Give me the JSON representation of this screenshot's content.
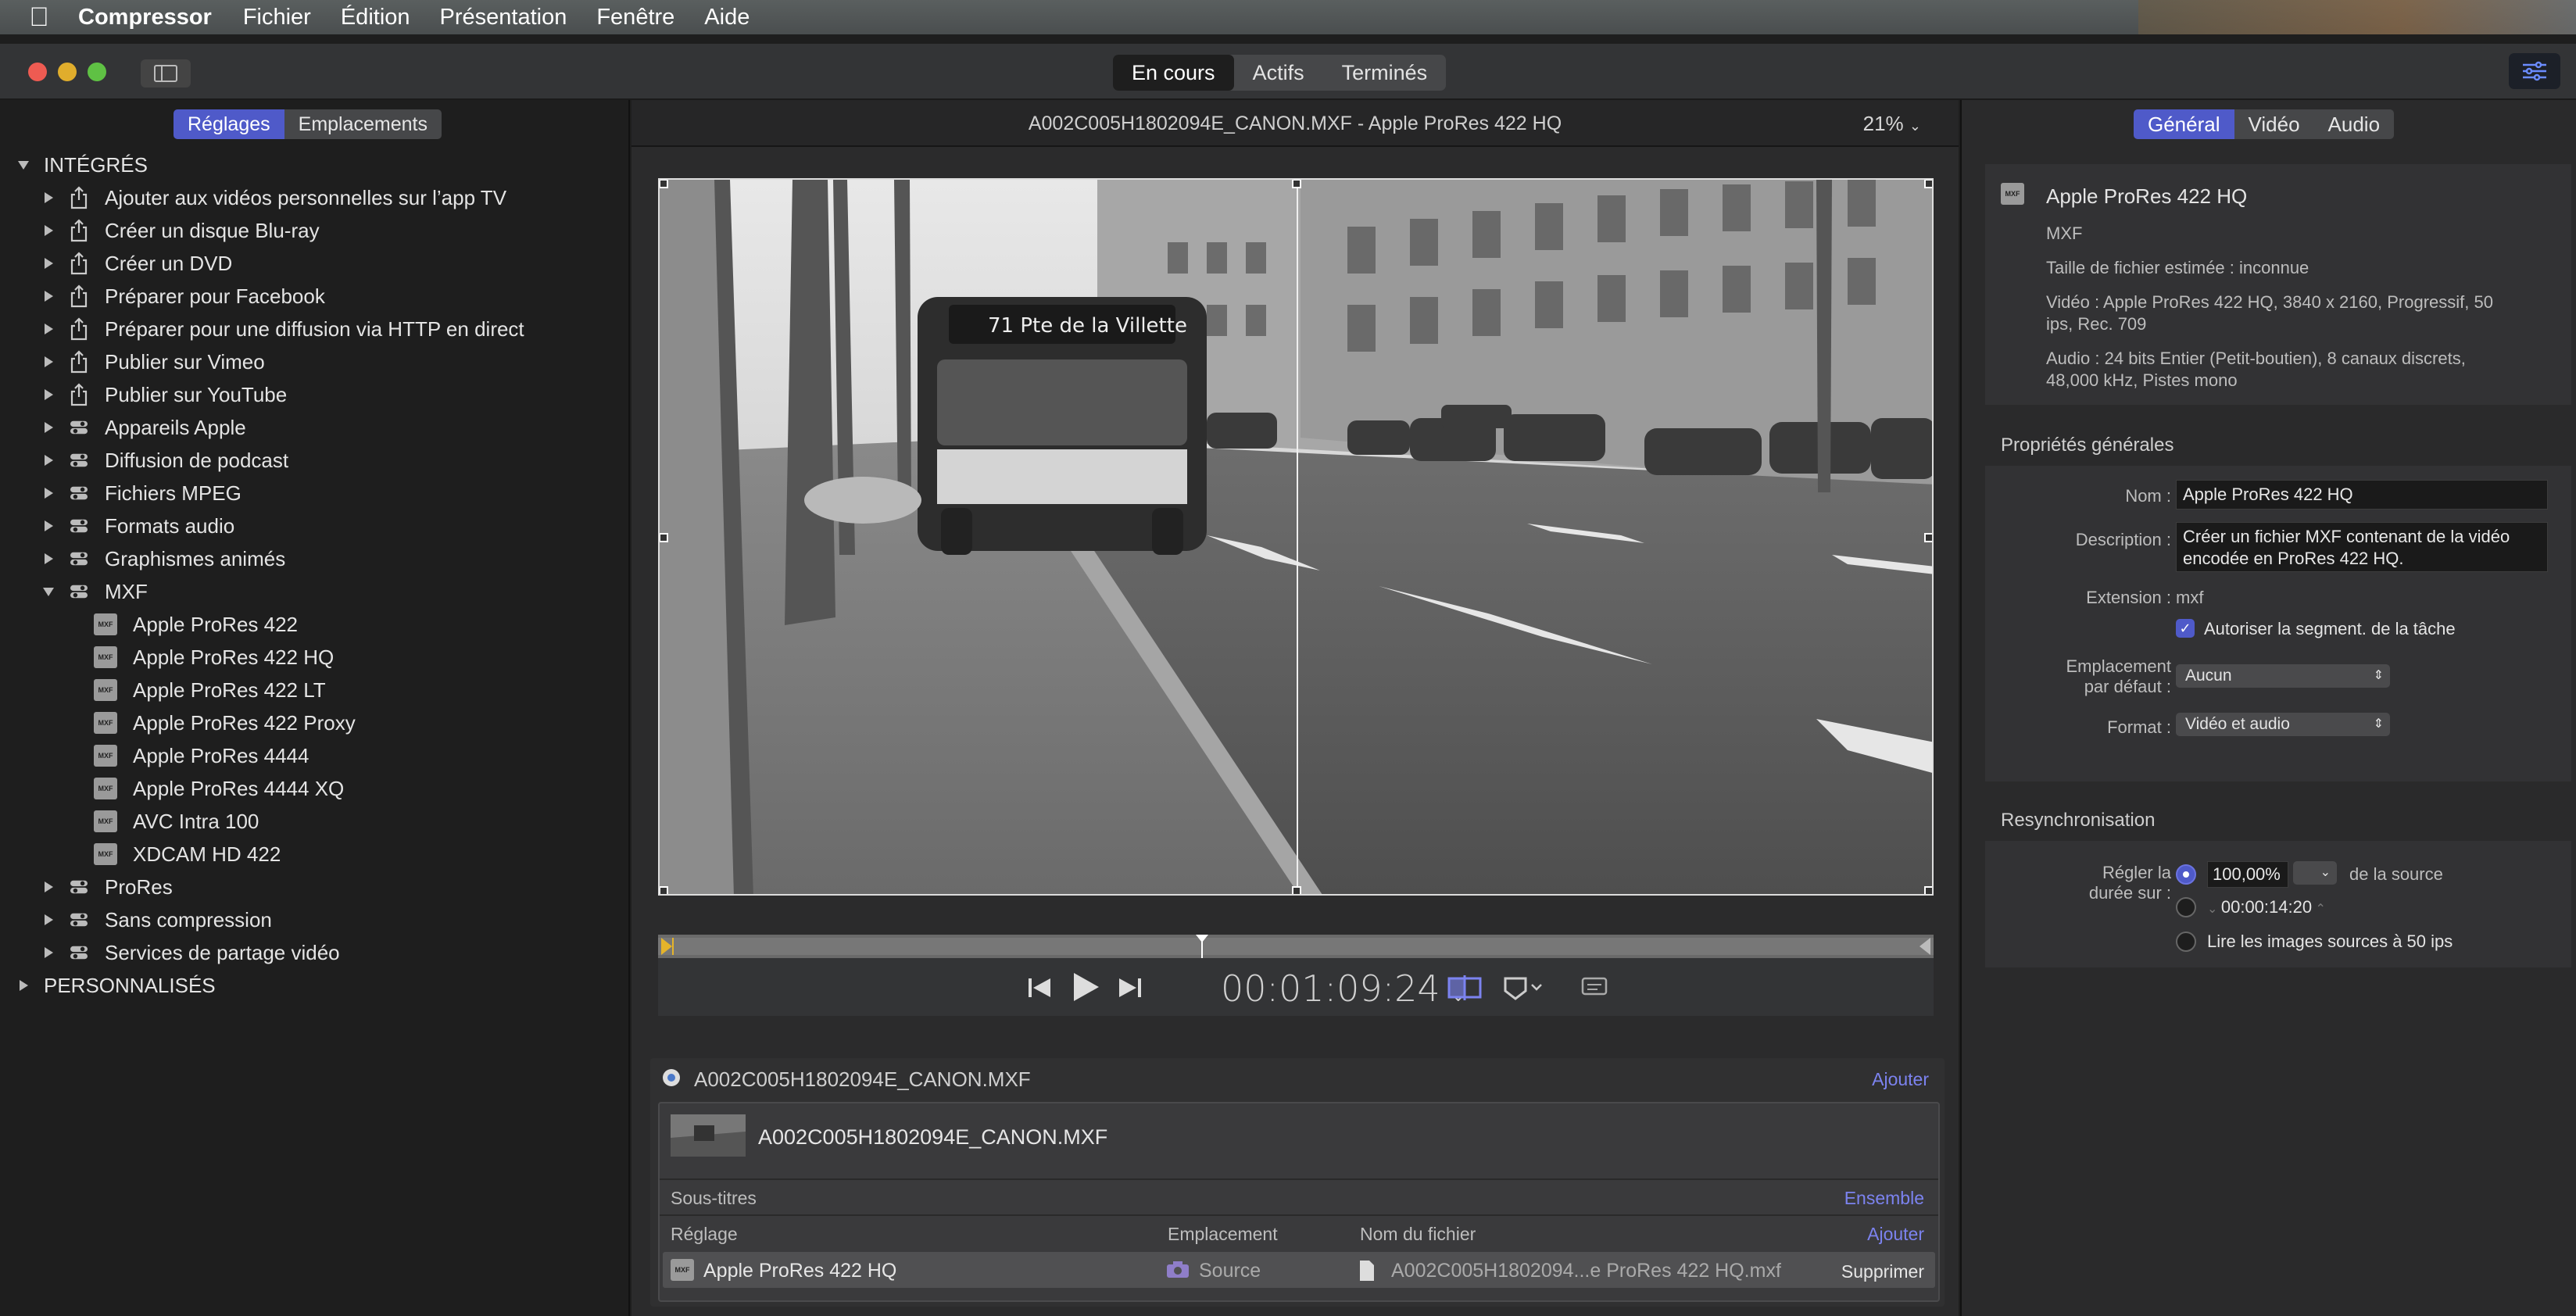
{
  "menubar": {
    "app": "Compressor",
    "items": [
      "Fichier",
      "Édition",
      "Présentation",
      "Fenêtre",
      "Aide"
    ]
  },
  "toolbar": {
    "segments": [
      "En cours",
      "Actifs",
      "Terminés"
    ]
  },
  "left_panel": {
    "tabs": [
      "Réglages",
      "Emplacements"
    ],
    "tree": {
      "builtin_header": "INTÉGRÉS",
      "share_items": [
        "Ajouter aux vidéos personnelles sur l’app TV",
        "Créer un disque Blu-ray",
        "Créer un DVD",
        "Préparer pour Facebook",
        "Préparer pour une diffusion via HTTP en direct",
        "Publier sur Vimeo",
        "Publier sur YouTube"
      ],
      "groups_before": [
        "Appareils Apple",
        "Diffusion de podcast",
        "Fichiers MPEG",
        "Formats audio",
        "Graphismes animés"
      ],
      "expanded_group": "MXF",
      "mxf_items": [
        "Apple ProRes 422",
        "Apple ProRes 422 HQ",
        "Apple ProRes 422 LT",
        "Apple ProRes 422 Proxy",
        "Apple ProRes 4444",
        "Apple ProRes 4444 XQ",
        "AVC Intra 100",
        "XDCAM HD 422"
      ],
      "groups_after": [
        "ProRes",
        "Sans compression",
        "Services de partage vidéo"
      ],
      "custom_header": "PERSONNALISÉS",
      "mxf_badge": "MXF"
    }
  },
  "viewer": {
    "title": "A002C005H1802094E_CANON.MXF - Apple ProRes 422 HQ",
    "zoom": "21%",
    "timecode": "00:01:09:24",
    "bus_sign": "71  Pte de la Villette"
  },
  "job": {
    "source_name": "A002C005H1802094E_CANON.MXF",
    "add_label": "Ajouter",
    "card_name": "A002C005H1802094E_CANON.MXF",
    "subtitles_label": "Sous-titres",
    "ensemble_label": "Ensemble",
    "col_setting": "Réglage",
    "col_location": "Emplacement",
    "col_filename": "Nom du fichier",
    "add_label2": "Ajouter",
    "row": {
      "setting": "Apple ProRes 422 HQ",
      "location": "Source",
      "filename": "A002C005H1802094...e ProRes 422 HQ.mxf",
      "delete": "Supprimer"
    }
  },
  "inspector": {
    "tabs": [
      "Général",
      "Vidéo",
      "Audio"
    ],
    "summary": {
      "title": "Apple ProRes 422 HQ",
      "format": "MXF",
      "size": "Taille de fichier estimée : inconnue",
      "video_1": "Vidéo : Apple ProRes 422 HQ, 3840 x 2160, Progressif, 50",
      "video_2": "ips, Rec. 709",
      "audio_1": "Audio : 24 bits Entier (Petit-boutien), 8 canaux discrets,",
      "audio_2": "48,000 kHz, Pistes mono"
    },
    "general": {
      "header": "Propriétés générales",
      "name_label": "Nom :",
      "name_value": "Apple ProRes 422 HQ",
      "desc_label": "Description :",
      "desc_1": "Créer un fichier MXF contenant de la vidéo",
      "desc_2": "encodée en ProRes 422 HQ.",
      "ext_label": "Extension :",
      "ext_value": "mxf",
      "segment_label": "Autoriser la segment. de la tâche",
      "location_label_1": "Emplacement",
      "location_label_2": "par défaut :",
      "location_value": "Aucun",
      "format_label": "Format :",
      "format_value": "Vidéo et audio"
    },
    "resync": {
      "header": "Resynchronisation",
      "label_1": "Régler la",
      "label_2": "durée sur :",
      "percent": "100,00%",
      "of_source": "de la source",
      "duration": "00:00:14:20",
      "read_label": "Lire les images sources à 50 ips"
    }
  }
}
